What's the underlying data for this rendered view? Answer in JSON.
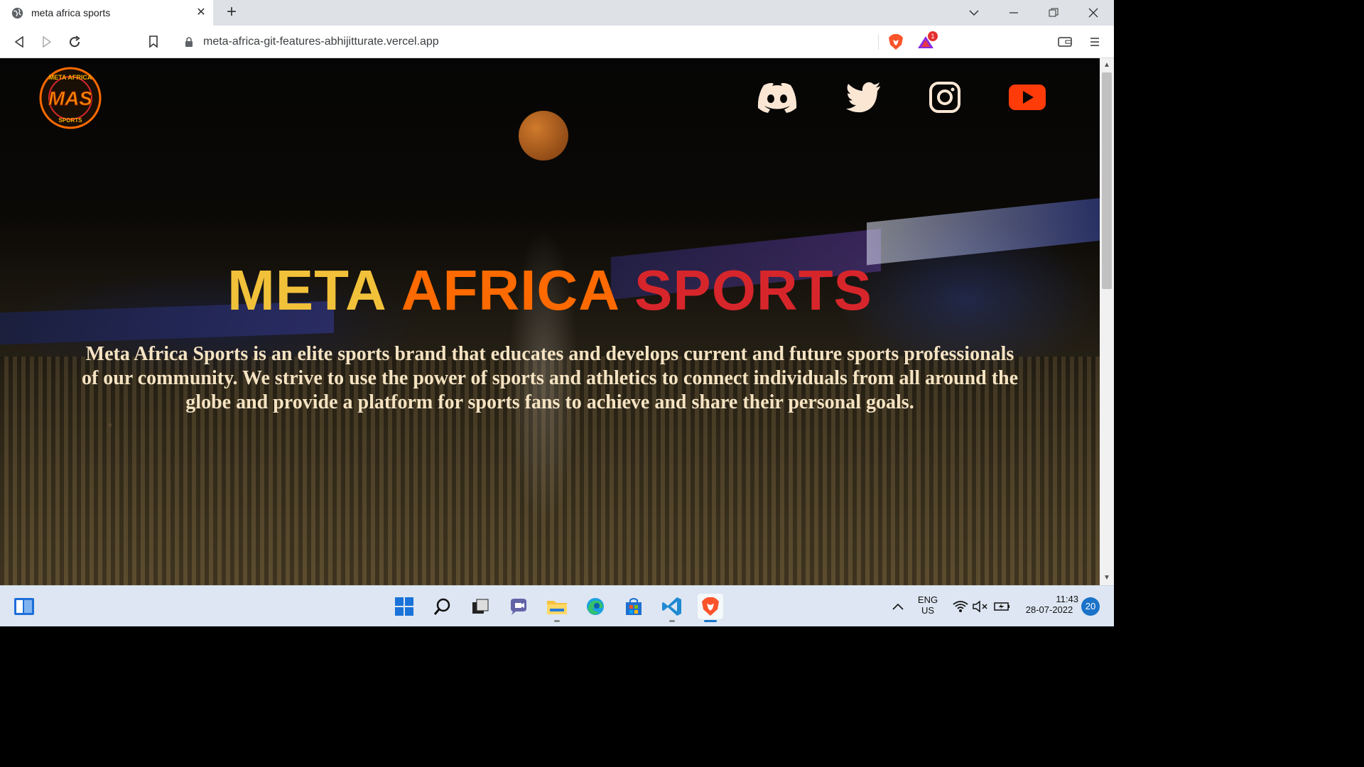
{
  "browser": {
    "tab_title": "meta africa sports",
    "url": "meta-africa-git-features-abhijitturate.vercel.app",
    "extension_badge": "1"
  },
  "page": {
    "hero_title_words": [
      "META",
      "AFRICA",
      "SPORTS"
    ],
    "hero_title_colors": [
      "#f2c13a",
      "#ff6a00",
      "#d7262b"
    ],
    "description": "Meta Africa Sports is an elite sports brand that educates and develops current and future sports professionals of our community. We strive to use the power of sports and athletics to connect individuals from all around the globe and provide a platform for sports fans to achieve and share their personal goals.",
    "logo_text": "MAS",
    "logo_ring_top": "META AFRICA",
    "logo_ring_bottom": "SPORTS",
    "socials": [
      "discord-icon",
      "twitter-icon",
      "instagram-icon",
      "youtube-icon"
    ],
    "accent": "#ff6a00"
  },
  "taskbar": {
    "language": "ENG",
    "region": "US",
    "time": "11:43",
    "date": "28-07-2022",
    "notification_count": "20"
  }
}
